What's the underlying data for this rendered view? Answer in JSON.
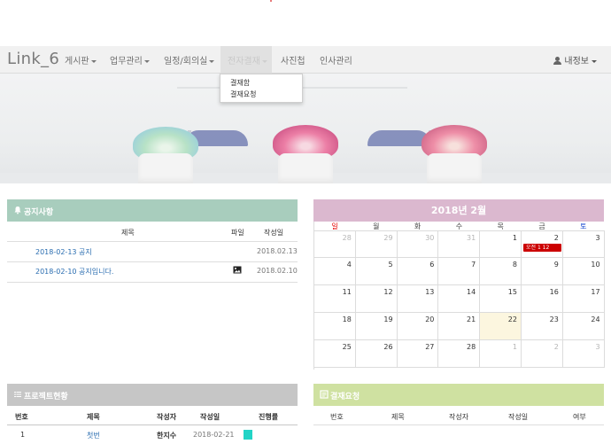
{
  "nav": {
    "brand": "Link_6",
    "items": [
      {
        "label": "게시판",
        "dropdown": true
      },
      {
        "label": "업무관리",
        "dropdown": true
      },
      {
        "label": "일정/회의실",
        "dropdown": true
      },
      {
        "label": "전자결재",
        "dropdown": true,
        "active": true
      },
      {
        "label": "사진첩",
        "dropdown": false
      },
      {
        "label": "인사관리",
        "dropdown": false
      }
    ],
    "user_label": "내정보"
  },
  "dropdown": {
    "items": [
      "결재함",
      "결재요청"
    ]
  },
  "notice": {
    "title": "공지사항",
    "columns": [
      "제목",
      "파일",
      "작성일"
    ],
    "rows": [
      {
        "title": "2018-02-13 공지",
        "has_file": false,
        "date": "2018.02.13"
      },
      {
        "title": "2018-02-10 공지입니다.",
        "has_file": true,
        "date": "2018.02.10"
      }
    ]
  },
  "calendar": {
    "title": "2018년 2월",
    "weekdays": [
      "일",
      "월",
      "화",
      "수",
      "목",
      "금",
      "토"
    ],
    "weekday_colors": {
      "sun": "#e60000",
      "sat": "#0a3dcc"
    },
    "weeks": [
      [
        "28",
        "29",
        "30",
        "31",
        "1",
        "2",
        "3"
      ],
      [
        "4",
        "5",
        "6",
        "7",
        "8",
        "9",
        "10"
      ],
      [
        "11",
        "12",
        "13",
        "14",
        "15",
        "16",
        "17"
      ],
      [
        "18",
        "19",
        "20",
        "21",
        "22",
        "23",
        "24"
      ],
      [
        "25",
        "26",
        "27",
        "28",
        "1",
        "2",
        "3"
      ]
    ],
    "today": "22",
    "event": {
      "day": "2",
      "label": "오전 1 12"
    }
  },
  "project": {
    "title": "프로젝트현황",
    "columns": [
      "번호",
      "제목",
      "작성자",
      "작성일",
      "진행률"
    ],
    "rows": [
      {
        "no": "1",
        "title": "첫번",
        "author": "한지수",
        "date": "2018-02-21"
      }
    ]
  },
  "approval": {
    "title": "결재요청",
    "columns": [
      "번호",
      "제목",
      "작성자",
      "작성일",
      "여부"
    ]
  },
  "colors": {
    "notice_header": "#a8cdbd",
    "calendar_header": "#dbb8cf",
    "project_header": "#c6c6c6",
    "approval_header": "#cfe1a1",
    "event": "#cc0000",
    "progress": "#22d4c6"
  }
}
